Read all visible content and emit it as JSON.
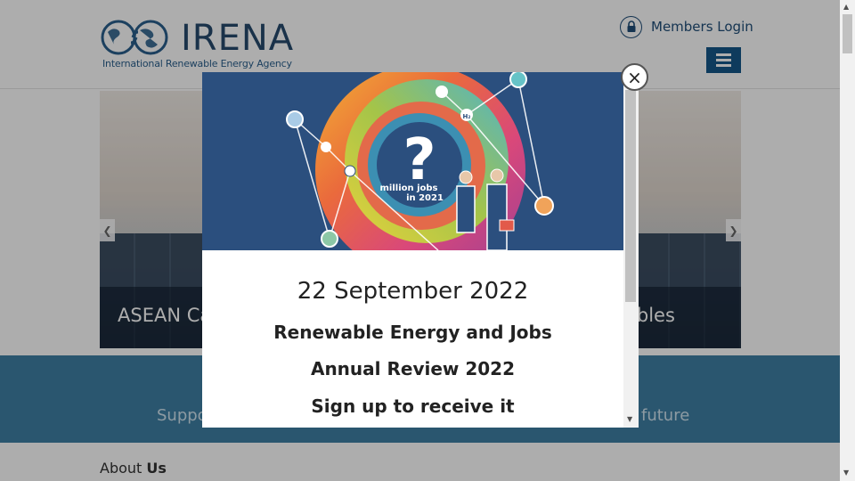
{
  "header": {
    "logo_wordmark": "IRENA",
    "logo_tagline": "International Renewable Energy Agency",
    "members_login": "Members Login"
  },
  "hero": {
    "caption_left": "ASEAN Ca",
    "caption_right": "ables"
  },
  "band": {
    "text_left": "Suppo",
    "text_right": "future"
  },
  "about": {
    "prefix": "About ",
    "bold": "Us"
  },
  "modal": {
    "banner": {
      "symbol": "?",
      "line1": "million jobs",
      "line2": "in 2021",
      "h2_label": "H₂"
    },
    "date": "22 September 2022",
    "headline_1": "Renewable Energy and Jobs",
    "headline_2": "Annual Review 2022",
    "headline_3": "Sign up to receive it",
    "close_glyph": "×"
  },
  "colors": {
    "brand_navy": "#274b6d",
    "menu_blue": "#16578a",
    "band_blue": "#3e7fa4",
    "banner_bg": "#2b4f7e"
  },
  "icons": [
    "lock-icon",
    "menu-icon",
    "chevron-left-icon",
    "chevron-right-icon",
    "close-icon",
    "scroll-up-icon",
    "scroll-down-icon"
  ]
}
